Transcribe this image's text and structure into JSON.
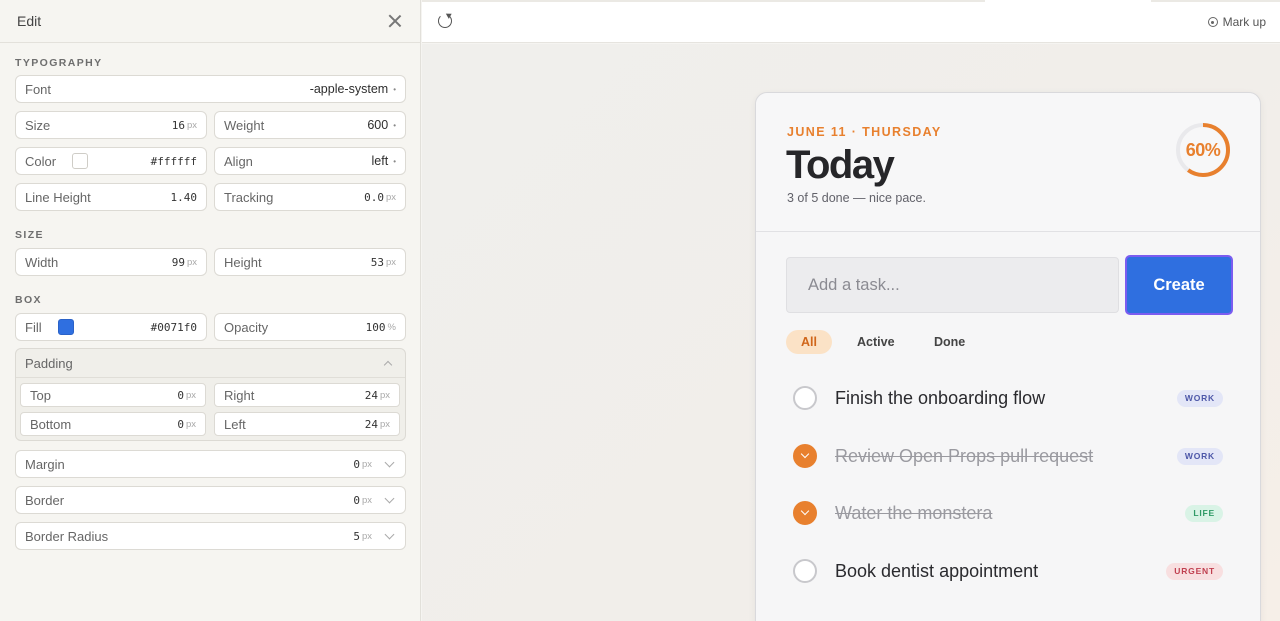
{
  "panel": {
    "title": "Edit",
    "sections": {
      "typography": "TYPOGRAPHY",
      "size": "SIZE",
      "box": "BOX"
    },
    "font": {
      "label": "Font",
      "value": "-apple-system"
    },
    "size": {
      "label": "Size",
      "value": "16",
      "unit": "px"
    },
    "weight": {
      "label": "Weight",
      "value": "600"
    },
    "color": {
      "label": "Color",
      "value": "#ffffff",
      "swatch": "#ffffff"
    },
    "align": {
      "label": "Align",
      "value": "left"
    },
    "line_height": {
      "label": "Line Height",
      "value": "1.40"
    },
    "tracking": {
      "label": "Tracking",
      "value": "0.0",
      "unit": "px"
    },
    "width": {
      "label": "Width",
      "value": "99",
      "unit": "px"
    },
    "height": {
      "label": "Height",
      "value": "53",
      "unit": "px"
    },
    "fill": {
      "label": "Fill",
      "value": "#0071f0",
      "swatch": "#2f6fe0"
    },
    "opacity": {
      "label": "Opacity",
      "value": "100",
      "unit": "%"
    },
    "padding": {
      "label": "Padding",
      "top": {
        "label": "Top",
        "value": "0",
        "unit": "px"
      },
      "right": {
        "label": "Right",
        "value": "24",
        "unit": "px"
      },
      "bottom": {
        "label": "Bottom",
        "value": "0",
        "unit": "px"
      },
      "left": {
        "label": "Left",
        "value": "24",
        "unit": "px"
      }
    },
    "margin": {
      "label": "Margin",
      "value": "0",
      "unit": "px"
    },
    "border": {
      "label": "Border",
      "value": "0",
      "unit": "px"
    },
    "border_radius": {
      "label": "Border Radius",
      "value": "5",
      "unit": "px"
    }
  },
  "toolbar": {
    "markup_label": "Mark up"
  },
  "card": {
    "date": "JUNE 11 · THURSDAY",
    "title": "Today",
    "subtitle": "3 of 5 done — nice pace.",
    "progress_label": "60%",
    "progress_fraction": 0.6,
    "accent": "#e8802e",
    "input_placeholder": "Add a task...",
    "create_label": "Create",
    "filters": [
      "All",
      "Active",
      "Done"
    ],
    "tasks": [
      {
        "text": "Finish the onboarding flow",
        "done": false,
        "tag": "WORK"
      },
      {
        "text": "Review Open Props pull request",
        "done": true,
        "tag": "WORK"
      },
      {
        "text": "Water the monstera",
        "done": true,
        "tag": "LIFE"
      },
      {
        "text": "Book dentist appointment",
        "done": false,
        "tag": "URGENT"
      }
    ]
  }
}
